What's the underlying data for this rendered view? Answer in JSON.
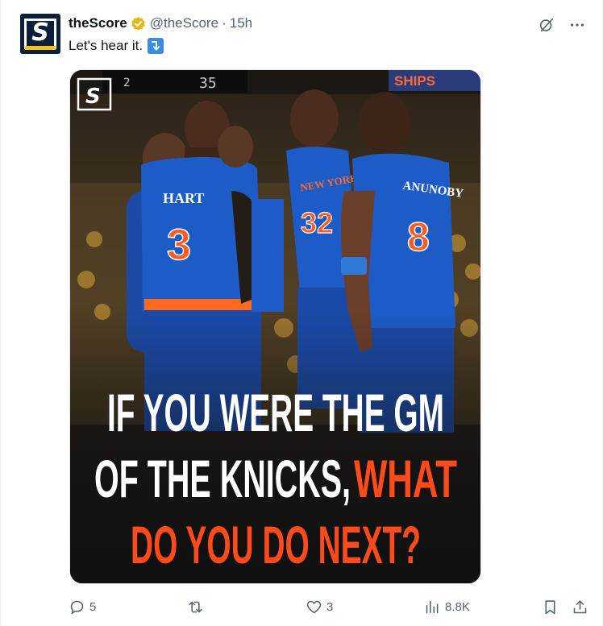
{
  "author": {
    "name": "theScore",
    "handle": "@theScore",
    "separator": "·",
    "time": "15h",
    "avatar_letter": "S"
  },
  "tweet": {
    "text": "Let's hear it."
  },
  "media": {
    "logo_letter": "S",
    "scoreboard_left": "2",
    "scoreboard_right": "35",
    "banner": "SHIPS",
    "jersey_left": {
      "name": "HART",
      "number": "3"
    },
    "jersey_middle": {
      "team": "NEW YORK",
      "number": "32"
    },
    "jersey_right": {
      "name": "ANUNOBY",
      "number": "8"
    },
    "headline_line1": "IF YOU WERE THE GM",
    "headline_line2_white": "OF THE KNICKS, ",
    "headline_line2_orange": "WHAT",
    "headline_line3": "DO YOU DO NEXT?",
    "colors": {
      "white": "#ffffff",
      "orange": "#ff4a1c",
      "knicks_blue": "#1d5cc7"
    }
  },
  "actions": {
    "replies": "5",
    "retweets": "",
    "likes": "3",
    "views": "8.8K"
  }
}
